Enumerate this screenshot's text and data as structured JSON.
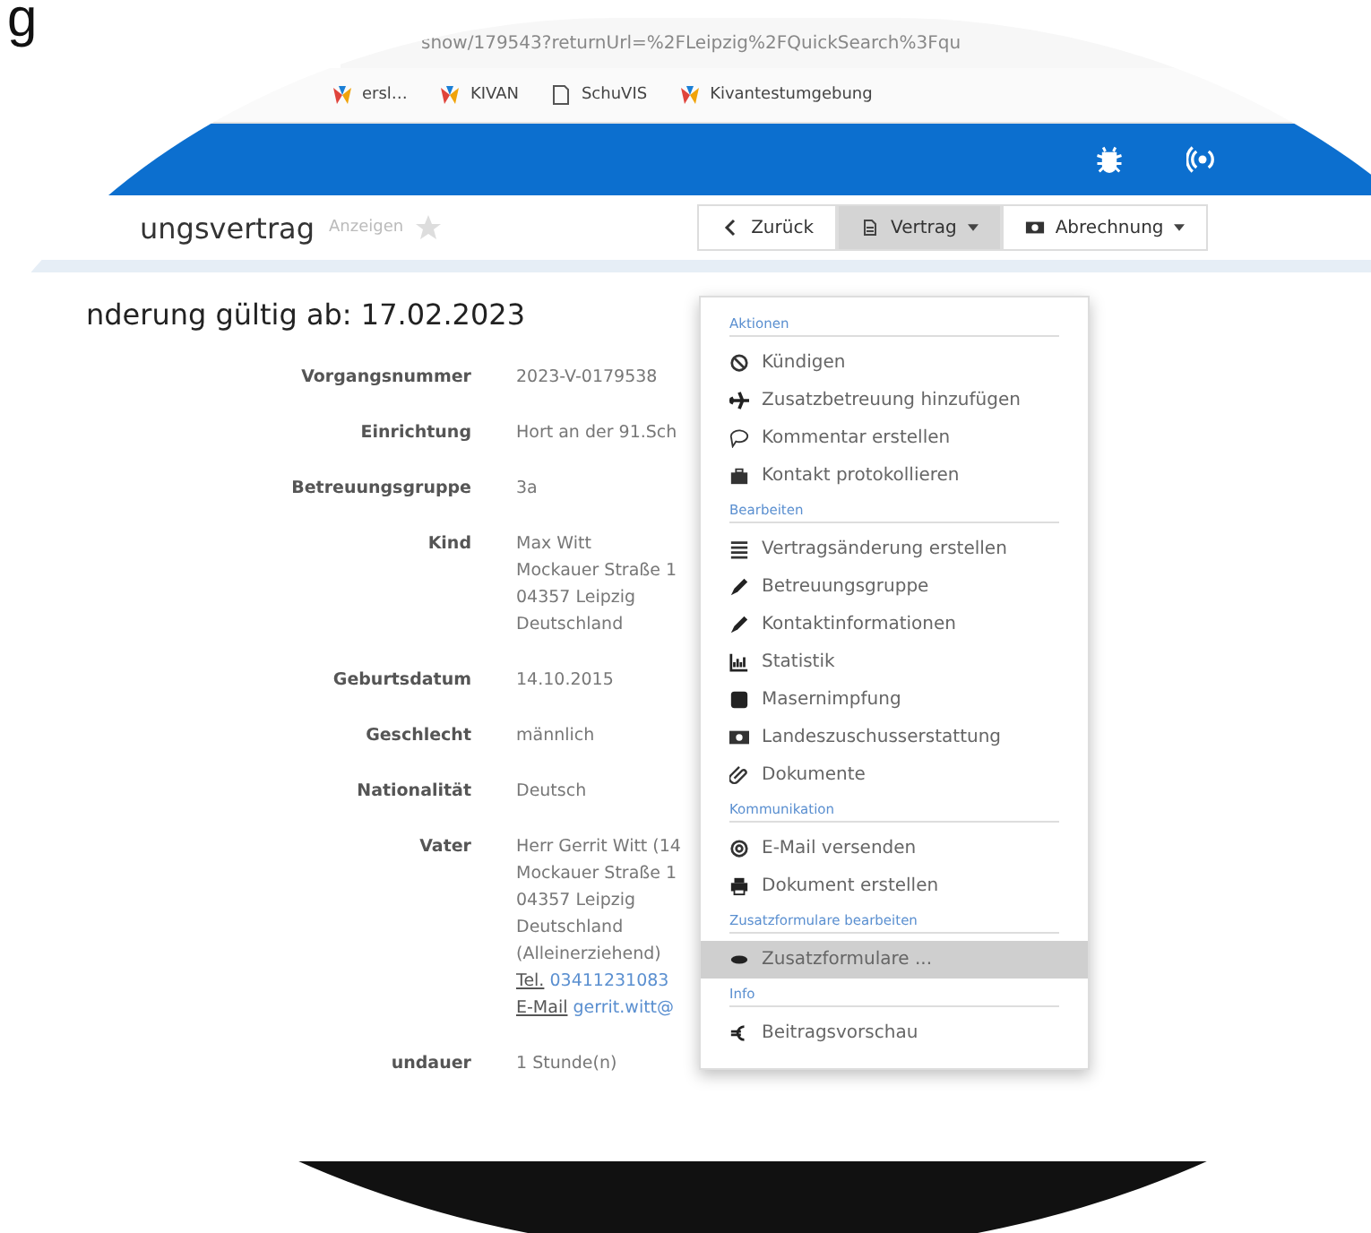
{
  "corner_letter": "g",
  "browser": {
    "url": "show/179543?returnUrl=%2FLeipzig%2FQuickSearch%3Fqu",
    "bookmarks": [
      {
        "label": "ersl…",
        "kind": "logo"
      },
      {
        "label": "KIVAN",
        "kind": "logo"
      },
      {
        "label": "SchuVIS",
        "kind": "page"
      },
      {
        "label": "Kivantestumgebung",
        "kind": "logo"
      }
    ]
  },
  "page_header": {
    "title": "ungsvertrag",
    "action": "Anzeigen",
    "buttons": [
      {
        "label": "Zurück",
        "kind": "back",
        "selected": false
      },
      {
        "label": "Vertrag",
        "kind": "doc",
        "selected": true
      },
      {
        "label": "Abrechnung",
        "kind": "money",
        "selected": false
      }
    ]
  },
  "heading": "nderung gültig ab: 17.02.2023",
  "details": [
    {
      "label": "Vorgangsnummer",
      "lines": [
        "2023-V-0179538"
      ]
    },
    {
      "label": "Einrichtung",
      "lines": [
        "Hort an der 91.Sch"
      ]
    },
    {
      "label": "Betreuungsgruppe",
      "lines": [
        "3a"
      ]
    },
    {
      "label": "Kind",
      "lines": [
        "Max Witt",
        "Mockauer Straße 1",
        "04357 Leipzig",
        "Deutschland"
      ]
    },
    {
      "label": "Geburtsdatum",
      "lines": [
        "14.10.2015"
      ]
    },
    {
      "label": "Geschlecht",
      "lines": [
        "männlich"
      ]
    },
    {
      "label": "Nationalität",
      "lines": [
        "Deutsch"
      ]
    },
    {
      "label": "Vater",
      "lines": [
        "Herr Gerrit Witt (14",
        "Mockauer Straße 1",
        "04357 Leipzig",
        "Deutschland",
        "(Alleinerziehend)"
      ],
      "phone_label": "Tel.",
      "phone": "03411231083",
      "email_label": "E-Mail",
      "email": "gerrit.witt@"
    },
    {
      "label": "undauer",
      "lines": [
        "1 Stunde(n)"
      ]
    }
  ],
  "menu": [
    {
      "title": "Aktionen",
      "items": [
        {
          "label": "Kündigen",
          "kind": "ban",
          "selected": false
        },
        {
          "label": "Zusatzbetreuung hinzufügen",
          "kind": "plane",
          "selected": false
        },
        {
          "label": "Kommentar erstellen",
          "kind": "comment",
          "selected": false
        },
        {
          "label": "Kontakt protokollieren",
          "kind": "case",
          "selected": false
        }
      ]
    },
    {
      "title": "Bearbeiten",
      "items": [
        {
          "label": "Vertragsänderung erstellen",
          "kind": "list",
          "selected": false
        },
        {
          "label": "Betreuungsgruppe",
          "kind": "pencil",
          "selected": false
        },
        {
          "label": "Kontaktinformationen",
          "kind": "pencil",
          "selected": false
        },
        {
          "label": "Statistik",
          "kind": "chart",
          "selected": false
        },
        {
          "label": "Masernimpfung",
          "kind": "square",
          "selected": false
        },
        {
          "label": "Landeszuschusserstattung",
          "kind": "money",
          "selected": false
        },
        {
          "label": "Dokumente",
          "kind": "clip",
          "selected": false
        }
      ]
    },
    {
      "title": "Kommunikation",
      "items": [
        {
          "label": "E-Mail versenden",
          "kind": "at",
          "selected": false
        },
        {
          "label": "Dokument erstellen",
          "kind": "print",
          "selected": false
        }
      ]
    },
    {
      "title": "Zusatzformulare bearbeiten",
      "items": [
        {
          "label": "Zusatzformulare ...",
          "kind": "eye",
          "selected": true
        }
      ]
    },
    {
      "title": "Info",
      "items": [
        {
          "label": "Beitragsvorschau",
          "kind": "euro",
          "selected": false
        }
      ]
    }
  ]
}
